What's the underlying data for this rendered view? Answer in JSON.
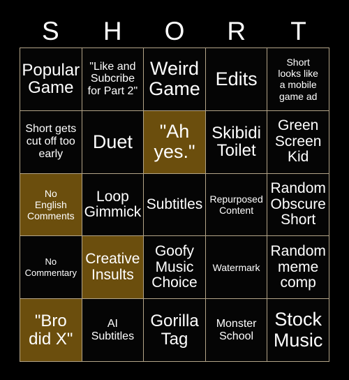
{
  "card": {
    "title_letters": [
      "S",
      "H",
      "O",
      "R",
      "T"
    ],
    "marked_color": "#6b4e0d",
    "unmarked_color": "#050505",
    "border_color": "#b3a488",
    "text_color": "#ffffff",
    "background_color": "#000000"
  },
  "cells": [
    {
      "text": "Popular\nGame",
      "marked": false,
      "size": "fs-lg"
    },
    {
      "text": "\"Like and\nSubcribe\nfor Part 2\"",
      "marked": false,
      "size": "fs-sm"
    },
    {
      "text": "Weird\nGame",
      "marked": false,
      "size": "fs-xl"
    },
    {
      "text": "Edits",
      "marked": false,
      "size": "fs-xl"
    },
    {
      "text": "Short\nlooks like\na mobile\ngame ad",
      "marked": false,
      "size": "fs-xs"
    },
    {
      "text": "Short gets\ncut off too\nearly",
      "marked": false,
      "size": "fs-sm"
    },
    {
      "text": "Duet",
      "marked": false,
      "size": "fs-xl"
    },
    {
      "text": "\"Ah\nyes.\"",
      "marked": true,
      "size": "fs-xl"
    },
    {
      "text": "Skibidi\nToilet",
      "marked": false,
      "size": "fs-lg"
    },
    {
      "text": "Green\nScreen\nKid",
      "marked": false,
      "size": "fs-md"
    },
    {
      "text": "No\nEnglish\nComments",
      "marked": true,
      "size": "fs-xs"
    },
    {
      "text": "Loop\nGimmick",
      "marked": false,
      "size": "fs-md"
    },
    {
      "text": "Subtitles",
      "marked": false,
      "size": "fs-md"
    },
    {
      "text": "Repurposed\nContent",
      "marked": false,
      "size": "fs-xs"
    },
    {
      "text": "Random\nObscure\nShort",
      "marked": false,
      "size": "fs-md"
    },
    {
      "text": "No\nCommentary",
      "marked": false,
      "size": "fs-xxs"
    },
    {
      "text": "Creative\nInsults",
      "marked": true,
      "size": "fs-md"
    },
    {
      "text": "Goofy\nMusic\nChoice",
      "marked": false,
      "size": "fs-md"
    },
    {
      "text": "Watermark",
      "marked": false,
      "size": "fs-xs"
    },
    {
      "text": "Random\nmeme\ncomp",
      "marked": false,
      "size": "fs-md"
    },
    {
      "text": "\"Bro\ndid X\"",
      "marked": true,
      "size": "fs-lg"
    },
    {
      "text": "AI\nSubtitles",
      "marked": false,
      "size": "fs-sm"
    },
    {
      "text": "Gorilla\nTag",
      "marked": false,
      "size": "fs-lg"
    },
    {
      "text": "Monster\nSchool",
      "marked": false,
      "size": "fs-sm"
    },
    {
      "text": "Stock\nMusic",
      "marked": false,
      "size": "fs-xl"
    }
  ]
}
